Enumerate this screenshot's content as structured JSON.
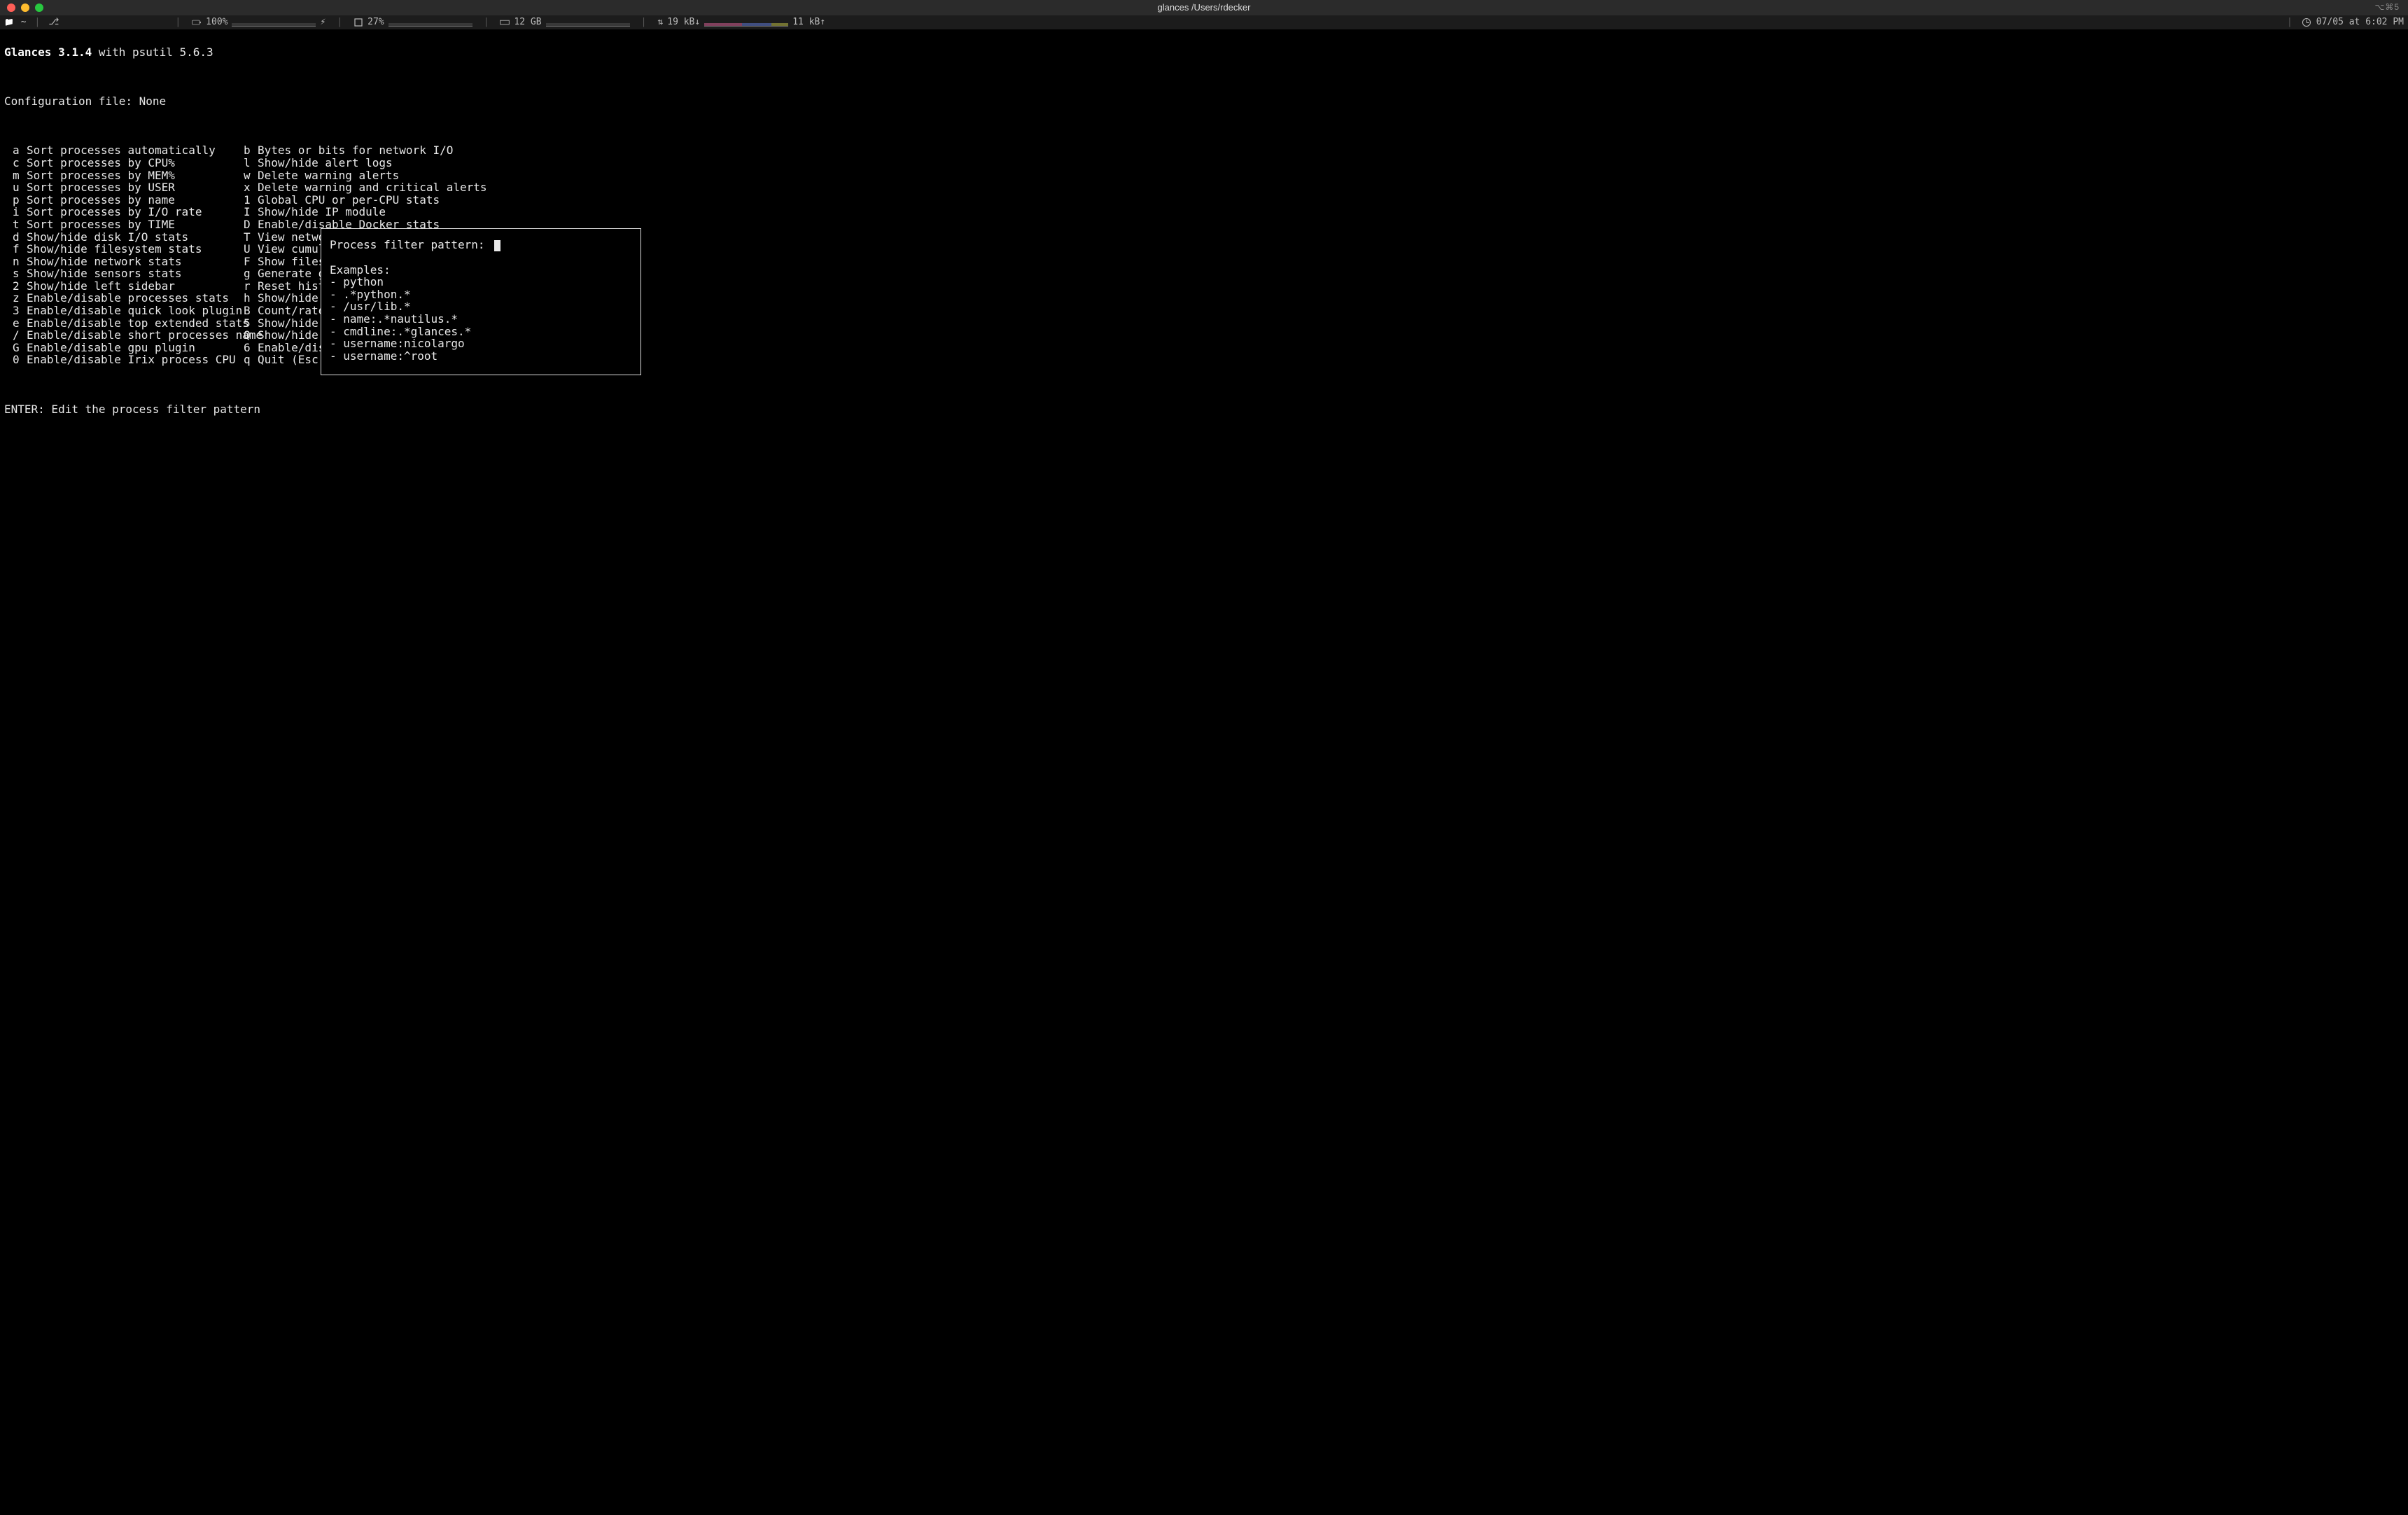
{
  "window": {
    "title": "glances /Users/rdecker",
    "right_hint": "⌥⌘5"
  },
  "statusbar": {
    "cwd": "~",
    "branch_indicator": "⎇",
    "batt1": {
      "icon": "🔋",
      "value": "100%"
    },
    "charge_glyph": "⚡",
    "cpu": {
      "icon": "□",
      "value": "27%"
    },
    "mem": {
      "icon": "▭",
      "value": "12 GB"
    },
    "net": {
      "icon_label": "⇵",
      "down": "19 kB↓",
      "up": "11 kB↑"
    },
    "clock": "07/05 at 6:02 PM"
  },
  "header": {
    "app": "Glances 3.1.4",
    "psutil": " with psutil 5.6.3",
    "config_line": "Configuration file: None"
  },
  "help": {
    "left": [
      {
        "k": "a",
        "d": "Sort processes automatically"
      },
      {
        "k": "c",
        "d": "Sort processes by CPU%"
      },
      {
        "k": "m",
        "d": "Sort processes by MEM%"
      },
      {
        "k": "u",
        "d": "Sort processes by USER"
      },
      {
        "k": "p",
        "d": "Sort processes by name"
      },
      {
        "k": "i",
        "d": "Sort processes by I/O rate"
      },
      {
        "k": "t",
        "d": "Sort processes by TIME"
      },
      {
        "k": "d",
        "d": "Show/hide disk I/O stats"
      },
      {
        "k": "f",
        "d": "Show/hide filesystem stats"
      },
      {
        "k": "n",
        "d": "Show/hide network stats"
      },
      {
        "k": "s",
        "d": "Show/hide sensors stats"
      },
      {
        "k": "2",
        "d": "Show/hide left sidebar"
      },
      {
        "k": "z",
        "d": "Enable/disable processes stats"
      },
      {
        "k": "3",
        "d": "Enable/disable quick look plugin"
      },
      {
        "k": "e",
        "d": "Enable/disable top extended stats"
      },
      {
        "k": "/",
        "d": "Enable/disable short processes name"
      },
      {
        "k": "G",
        "d": "Enable/disable gpu plugin"
      },
      {
        "k": "0",
        "d": "Enable/disable Irix process CPU"
      }
    ],
    "right": [
      {
        "k": "b",
        "d": "Bytes or bits for network I/O"
      },
      {
        "k": "l",
        "d": "Show/hide alert logs"
      },
      {
        "k": "w",
        "d": "Delete warning alerts"
      },
      {
        "k": "x",
        "d": "Delete warning and critical alerts"
      },
      {
        "k": "1",
        "d": "Global CPU or per-CPU stats"
      },
      {
        "k": "I",
        "d": "Show/hide IP module"
      },
      {
        "k": "D",
        "d": "Enable/disable Docker stats"
      },
      {
        "k": "T",
        "d": "View network I/O as combination"
      },
      {
        "k": "U",
        "d": "View cumulative network I/O"
      },
      {
        "k": "F",
        "d": "Show filesystem free space"
      },
      {
        "k": "g",
        "d": "Generate graphs for current history"
      },
      {
        "k": "r",
        "d": "Reset history"
      },
      {
        "k": "h",
        "d": "Show/hide t"
      },
      {
        "k": "B",
        "d": "Count/rate"
      },
      {
        "k": "5",
        "d": "Show/hide t"
      },
      {
        "k": "Q",
        "d": "Show/hide I"
      },
      {
        "k": "6",
        "d": "Enable/disa"
      },
      {
        "k": "q",
        "d": "Quit (Esc a"
      }
    ],
    "footer": "ENTER: Edit the process filter pattern"
  },
  "popup": {
    "prompt": "Process filter pattern:",
    "value": "",
    "examples_label": "Examples:",
    "examples": [
      "python",
      ".*python.*",
      "/usr/lib.*",
      "name:.*nautilus.*",
      "cmdline:.*glances.*",
      "username:nicolargo",
      "username:^root"
    ]
  }
}
